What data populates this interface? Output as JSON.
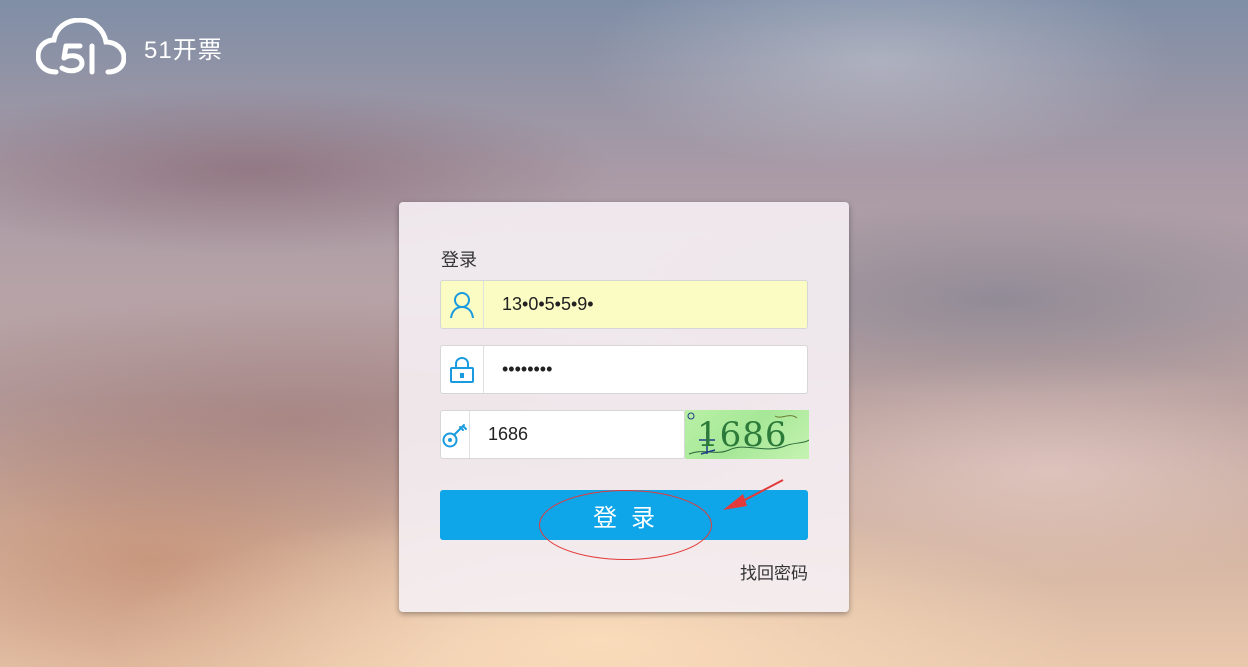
{
  "brand": {
    "name": "51开票",
    "logo_icon": "cloud-51-logo-icon"
  },
  "login": {
    "title": "登录",
    "username": {
      "value": "13•0•5•5•9•",
      "icon": "user-icon"
    },
    "password": {
      "value": "••••••••",
      "icon": "lock-icon"
    },
    "captcha": {
      "value": "1686",
      "icon": "key-icon",
      "image_text": "1686"
    },
    "submit_label": "登录",
    "forgot_label": "找回密码"
  },
  "colors": {
    "primary": "#0EA6E8",
    "autofill": "#FBFCC4",
    "annotation": "#E23A3A"
  }
}
